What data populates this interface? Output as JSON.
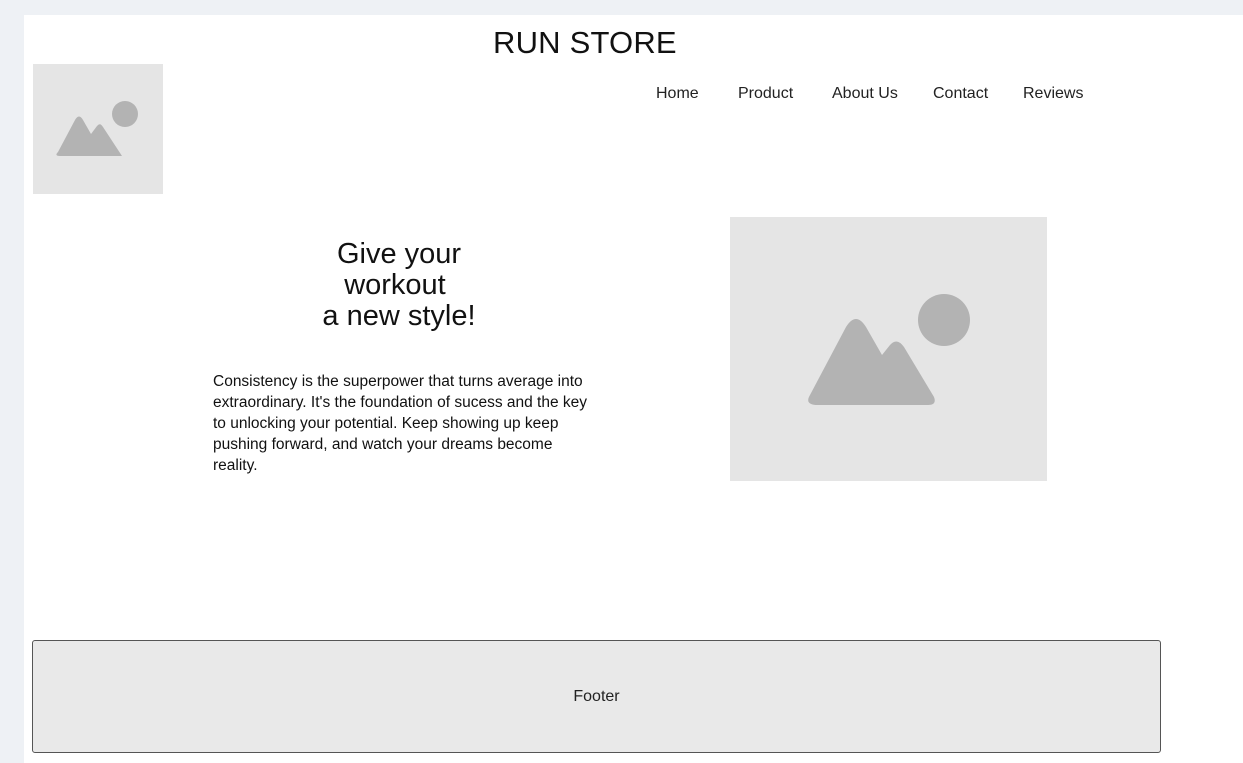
{
  "header": {
    "title": "RUN STORE",
    "logo_icon": "image-placeholder-icon"
  },
  "nav": {
    "items": [
      {
        "label": "Home"
      },
      {
        "label": "Product"
      },
      {
        "label": "About Us"
      },
      {
        "label": "Contact"
      },
      {
        "label": "Reviews"
      }
    ]
  },
  "hero": {
    "heading_lines": [
      "Give your",
      "workout ",
      "a new style!"
    ],
    "body": "Consistency is the superpower that turns average into extraordinary. It's the foundation of sucess and the key to unlocking your potential. Keep showing up keep pushing forward, and watch your dreams become reality.",
    "image_icon": "image-placeholder-icon"
  },
  "footer": {
    "label": "Footer"
  },
  "colors": {
    "placeholder_bg": "#e5e5e5",
    "placeholder_icon": "#b3b3b3",
    "footer_bg": "#e9e9e9"
  }
}
